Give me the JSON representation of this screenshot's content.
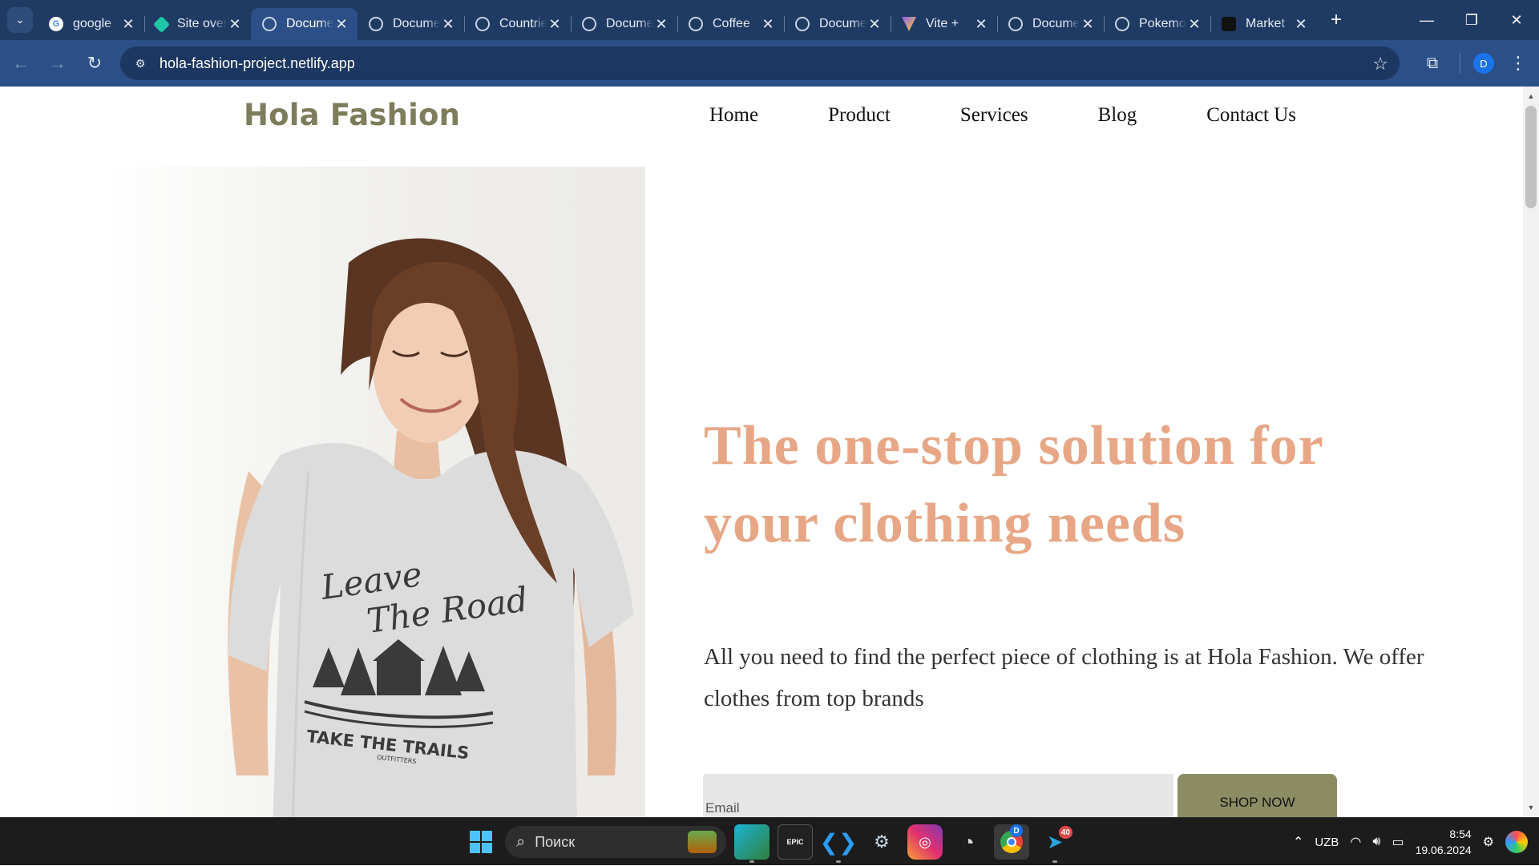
{
  "browser": {
    "tabs": [
      {
        "title": "google",
        "favicon": "google"
      },
      {
        "title": "Site overview",
        "favicon": "site"
      },
      {
        "title": "Document",
        "favicon": "globe",
        "active": true
      },
      {
        "title": "Document",
        "favicon": "globe"
      },
      {
        "title": "Countries",
        "favicon": "globe"
      },
      {
        "title": "Document",
        "favicon": "globe"
      },
      {
        "title": "Coffee",
        "favicon": "globe"
      },
      {
        "title": "Document",
        "favicon": "globe"
      },
      {
        "title": "Vite +",
        "favicon": "vite"
      },
      {
        "title": "Document",
        "favicon": "globe"
      },
      {
        "title": "Pokemon",
        "favicon": "globe"
      },
      {
        "title": "Market",
        "favicon": "market"
      }
    ],
    "url": "hola-fashion-project.netlify.app",
    "profile_initial": "D"
  },
  "site": {
    "logo": "Hola Fashion",
    "nav": [
      "Home",
      "Product",
      "Services",
      "Blog",
      "Contact Us"
    ],
    "headline": "The one-stop solution for your clothing needs",
    "subtext": "All you need to find the perfect piece of clothing is at Hola Fashion. We offer clothes from top brands",
    "email_placeholder": "Email",
    "cta_label": "SHOP NOW",
    "tshirt_print": {
      "line1": "Leave",
      "line2": "The Road",
      "line3": "TAKE THE TRAILS",
      "line4": "OUTFITTERS"
    }
  },
  "taskbar": {
    "search_placeholder": "Поиск",
    "language": "UZB",
    "time": "8:54",
    "date": "19.06.2024",
    "telegram_badge": "40",
    "chrome_badge": "D",
    "apps": [
      "edge-icon",
      "epic-games-icon",
      "vscode-icon",
      "steam-icon",
      "instagram-icon",
      "obs-icon",
      "chrome-icon",
      "telegram-icon"
    ]
  },
  "colors": {
    "chrome_dark": "#1f3a63",
    "chrome_toolbar": "#2b4f86",
    "logo": "#7d7c5b",
    "headline": "#e7a787",
    "cta": "#8c8c64",
    "input_bg": "#e6e6e6"
  }
}
